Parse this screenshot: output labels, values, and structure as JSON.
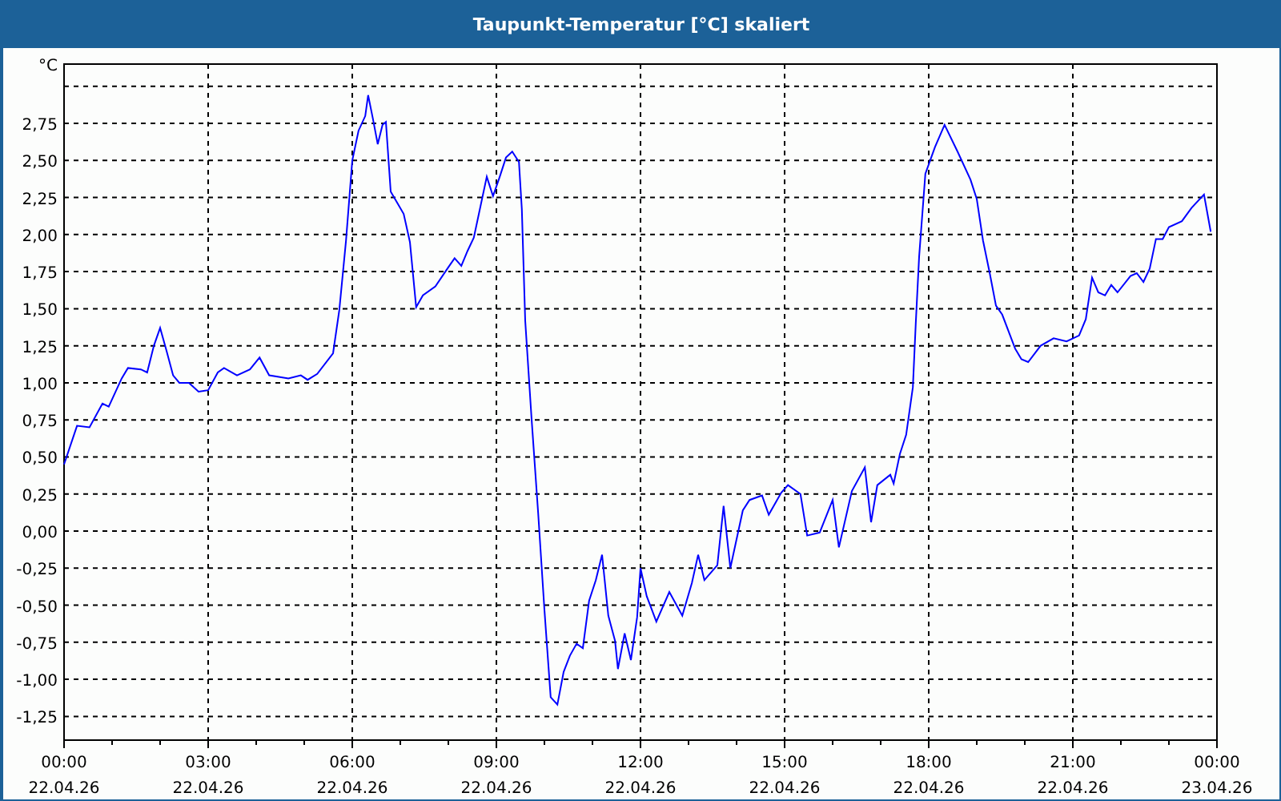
{
  "window": {
    "title": "Taupunkt-Temperatur [°C] skaliert"
  },
  "chart": {
    "x_dates": [
      "22.04.26",
      "22.04.26",
      "22.04.26",
      "22.04.26",
      "22.04.26",
      "22.04.26",
      "22.04.26",
      "22.04.26",
      "23.04.26"
    ],
    "chart_data": {
      "type": "line",
      "grid": true,
      "ylabel": "°C",
      "xlim": [
        0,
        24
      ],
      "ylim": [
        -1.41,
        3.15
      ],
      "xticks": [
        {
          "value": 0,
          "label": "00:00"
        },
        {
          "value": 3,
          "label": "03:00"
        },
        {
          "value": 6,
          "label": "06:00"
        },
        {
          "value": 9,
          "label": "09:00"
        },
        {
          "value": 12,
          "label": "12:00"
        },
        {
          "value": 15,
          "label": "15:00"
        },
        {
          "value": 18,
          "label": "18:00"
        },
        {
          "value": 21,
          "label": "21:00"
        },
        {
          "value": 24,
          "label": "00:00"
        }
      ],
      "yticks": [
        {
          "value": -1.25,
          "label": "-1,25"
        },
        {
          "value": -1,
          "label": "-1,00"
        },
        {
          "value": -0.75,
          "label": "-0,75"
        },
        {
          "value": -0.5,
          "label": "-0,50"
        },
        {
          "value": -0.25,
          "label": "-0,25"
        },
        {
          "value": 0,
          "label": "0,00"
        },
        {
          "value": 0.25,
          "label": "0,25"
        },
        {
          "value": 0.5,
          "label": "0,50"
        },
        {
          "value": 0.75,
          "label": "0,75"
        },
        {
          "value": 1,
          "label": "1,00"
        },
        {
          "value": 1.25,
          "label": "1,25"
        },
        {
          "value": 1.5,
          "label": "1,50"
        },
        {
          "value": 1.75,
          "label": "1,75"
        },
        {
          "value": 2,
          "label": "2,00"
        },
        {
          "value": 2.25,
          "label": "2,25"
        },
        {
          "value": 2.5,
          "label": "2,50"
        },
        {
          "value": 2.75,
          "label": "2,75"
        }
      ],
      "x": [
        0,
        0.27,
        0.53,
        0.8,
        0.93,
        1.2,
        1.33,
        1.6,
        1.73,
        1.87,
        2.0,
        2.13,
        2.27,
        2.4,
        2.6,
        2.8,
        3.0,
        3.2,
        3.33,
        3.6,
        3.87,
        4.07,
        4.27,
        4.47,
        4.67,
        4.93,
        5.07,
        5.27,
        5.6,
        5.73,
        5.87,
        6.0,
        6.13,
        6.27,
        6.33,
        6.43,
        6.53,
        6.63,
        6.7,
        6.8,
        7.07,
        7.2,
        7.33,
        7.47,
        7.73,
        8.0,
        8.13,
        8.27,
        8.4,
        8.53,
        8.8,
        8.93,
        9.07,
        9.2,
        9.33,
        9.47,
        9.53,
        9.6,
        9.73,
        9.87,
        10.0,
        10.13,
        10.27,
        10.4,
        10.53,
        10.67,
        10.8,
        10.93,
        11.07,
        11.2,
        11.33,
        11.47,
        11.53,
        11.67,
        11.8,
        11.93,
        12.0,
        12.13,
        12.33,
        12.6,
        12.87,
        13.07,
        13.2,
        13.33,
        13.6,
        13.73,
        13.87,
        14.13,
        14.27,
        14.53,
        14.67,
        14.93,
        15.07,
        15.33,
        15.47,
        15.73,
        16.0,
        16.13,
        16.4,
        16.67,
        16.8,
        16.93,
        17.2,
        17.27,
        17.4,
        17.53,
        17.67,
        17.73,
        17.8,
        17.93,
        18.13,
        18.33,
        18.6,
        18.87,
        19.0,
        19.13,
        19.27,
        19.4,
        19.53,
        19.8,
        19.93,
        20.07,
        20.33,
        20.6,
        20.87,
        21.13,
        21.27,
        21.4,
        21.53,
        21.67,
        21.8,
        21.93,
        22.2,
        22.33,
        22.47,
        22.6,
        22.73,
        22.87,
        23.0,
        23.27,
        23.47,
        23.73,
        23.87
      ],
      "series": [
        {
          "color": "#0000ff",
          "values": [
            0.45,
            0.71,
            0.7,
            0.86,
            0.84,
            1.03,
            1.1,
            1.09,
            1.07,
            1.25,
            1.37,
            1.22,
            1.05,
            1.0,
            1.0,
            0.94,
            0.95,
            1.07,
            1.1,
            1.05,
            1.09,
            1.17,
            1.05,
            1.04,
            1.03,
            1.05,
            1.02,
            1.06,
            1.2,
            1.49,
            1.96,
            2.5,
            2.7,
            2.8,
            2.94,
            2.78,
            2.61,
            2.74,
            2.76,
            2.29,
            2.14,
            1.95,
            1.51,
            1.59,
            1.65,
            1.78,
            1.84,
            1.79,
            1.89,
            1.98,
            2.39,
            2.26,
            2.39,
            2.52,
            2.56,
            2.49,
            2.17,
            1.42,
            0.77,
            0.12,
            -0.53,
            -1.12,
            -1.17,
            -0.95,
            -0.84,
            -0.76,
            -0.79,
            -0.47,
            -0.33,
            -0.16,
            -0.57,
            -0.74,
            -0.93,
            -0.69,
            -0.87,
            -0.58,
            -0.25,
            -0.44,
            -0.61,
            -0.41,
            -0.57,
            -0.35,
            -0.16,
            -0.33,
            -0.23,
            0.17,
            -0.25,
            0.14,
            0.21,
            0.24,
            0.11,
            0.26,
            0.31,
            0.25,
            -0.03,
            -0.01,
            0.21,
            -0.11,
            0.27,
            0.43,
            0.06,
            0.31,
            0.38,
            0.32,
            0.52,
            0.65,
            0.97,
            1.4,
            1.85,
            2.41,
            2.59,
            2.74,
            2.56,
            2.37,
            2.24,
            1.96,
            1.74,
            1.52,
            1.46,
            1.23,
            1.16,
            1.14,
            1.25,
            1.3,
            1.28,
            1.32,
            1.43,
            1.71,
            1.61,
            1.59,
            1.66,
            1.61,
            1.72,
            1.74,
            1.68,
            1.77,
            1.97,
            1.97,
            2.05,
            2.09,
            2.18,
            2.27,
            2.02
          ]
        }
      ]
    }
  }
}
